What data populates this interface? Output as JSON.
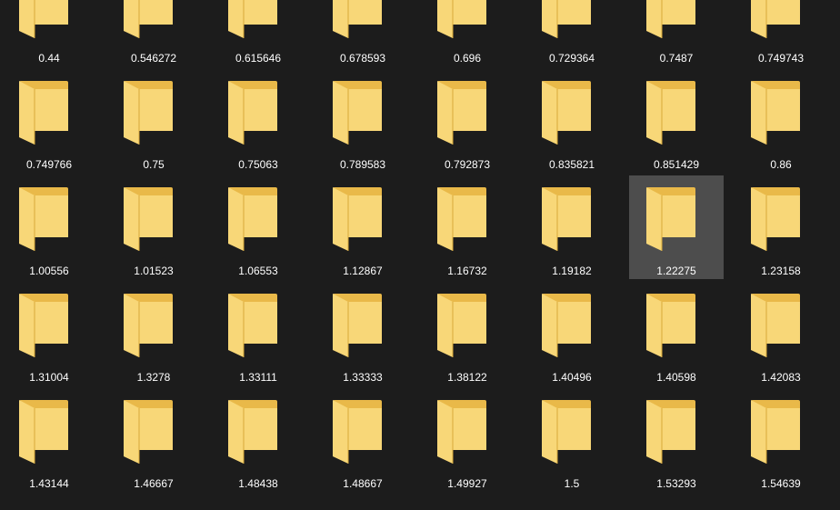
{
  "folders": [
    [
      "0.44",
      "0.546272",
      "0.615646",
      "0.678593",
      "0.696",
      "0.729364",
      "0.7487",
      "0.749743"
    ],
    [
      "0.749766",
      "0.75",
      "0.75063",
      "0.789583",
      "0.792873",
      "0.835821",
      "0.851429",
      "0.86"
    ],
    [
      "1.00556",
      "1.01523",
      "1.06553",
      "1.12867",
      "1.16732",
      "1.19182",
      "1.22275",
      "1.23158"
    ],
    [
      "1.31004",
      "1.3278",
      "1.33111",
      "1.33333",
      "1.38122",
      "1.40496",
      "1.40598",
      "1.42083"
    ],
    [
      "1.43144",
      "1.46667",
      "1.48438",
      "1.48667",
      "1.49927",
      "1.5",
      "1.53293",
      "1.54639"
    ]
  ],
  "selected": "1.22275",
  "colors": {
    "background": "#1c1c1c",
    "selection": "#4d4d4d",
    "folder_back": "#e9b949",
    "folder_front": "#f8d778",
    "label": "#ffffff"
  },
  "icon": "folder-icon"
}
